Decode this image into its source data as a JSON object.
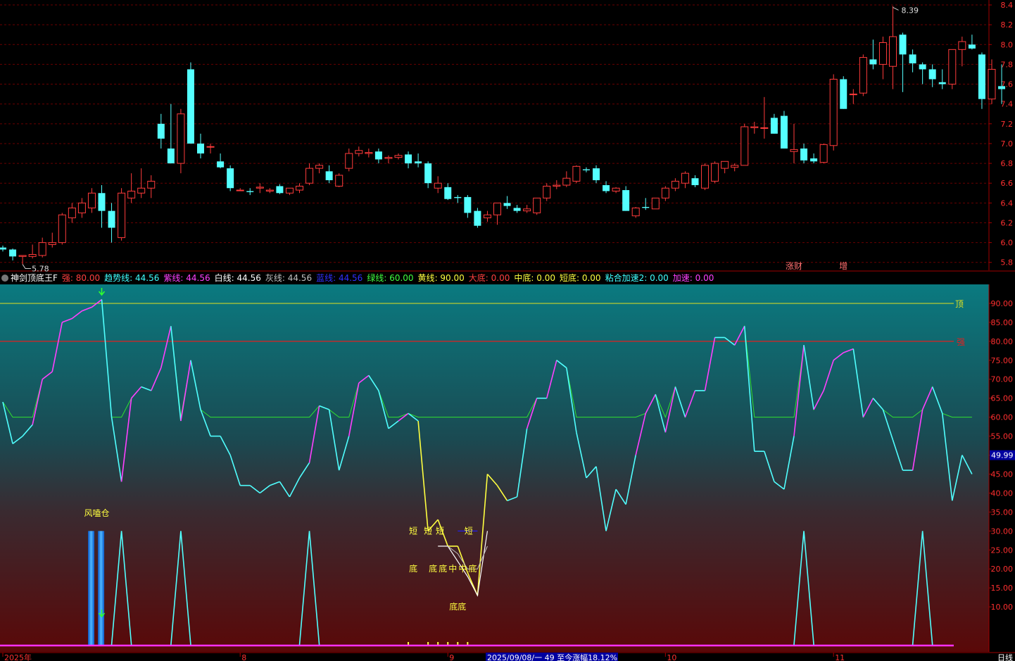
{
  "chart_data": [
    {
      "type": "candlestick",
      "y_ticks": [
        "8.4",
        "8.2",
        "8.0",
        "7.8",
        "7.6",
        "7.4",
        "7.2",
        "7.0",
        "6.8",
        "6.6",
        "6.4",
        "6.2",
        "6.0",
        "5.8"
      ],
      "ylim": [
        5.72,
        8.45
      ],
      "high_label": "8.39",
      "low_label": "5.78",
      "event_badges": [
        {
          "text": "涨财",
          "index": 80
        },
        {
          "text": "增",
          "index": 85
        }
      ],
      "up_color": "#ff3b3b",
      "down_color": "#54ffff",
      "candles": [
        [
          5.95,
          5.97,
          5.91,
          5.93
        ],
        [
          5.93,
          5.94,
          5.82,
          5.86
        ],
        [
          5.86,
          5.87,
          5.78,
          5.87
        ],
        [
          5.86,
          5.98,
          5.84,
          5.88
        ],
        [
          5.87,
          6.05,
          5.85,
          6.0
        ],
        [
          5.98,
          6.1,
          5.95,
          6.0
        ],
        [
          6.0,
          6.3,
          5.98,
          6.28
        ],
        [
          6.25,
          6.4,
          6.2,
          6.35
        ],
        [
          6.3,
          6.45,
          6.25,
          6.4
        ],
        [
          6.35,
          6.55,
          6.3,
          6.5
        ],
        [
          6.5,
          6.58,
          6.15,
          6.32
        ],
        [
          6.32,
          6.4,
          6.0,
          6.15
        ],
        [
          6.05,
          6.55,
          6.02,
          6.5
        ],
        [
          6.45,
          6.7,
          6.4,
          6.52
        ],
        [
          6.5,
          6.75,
          6.45,
          6.55
        ],
        [
          6.55,
          6.68,
          6.45,
          6.62
        ],
        [
          7.2,
          7.3,
          6.95,
          7.05
        ],
        [
          6.95,
          7.4,
          6.8,
          6.8
        ],
        [
          6.8,
          7.35,
          6.7,
          7.3
        ],
        [
          7.75,
          7.82,
          7.0,
          7.0
        ],
        [
          7.0,
          7.1,
          6.85,
          6.9
        ],
        [
          6.97,
          7.0,
          6.9,
          6.97
        ],
        [
          6.82,
          6.9,
          6.75,
          6.76
        ],
        [
          6.75,
          6.78,
          6.52,
          6.55
        ],
        [
          6.53,
          6.55,
          6.52,
          6.53
        ],
        [
          6.52,
          6.55,
          6.48,
          6.51
        ],
        [
          6.55,
          6.6,
          6.5,
          6.56
        ],
        [
          6.52,
          6.55,
          6.5,
          6.53
        ],
        [
          6.57,
          6.59,
          6.49,
          6.5
        ],
        [
          6.5,
          6.55,
          6.48,
          6.55
        ],
        [
          6.53,
          6.6,
          6.5,
          6.57
        ],
        [
          6.6,
          6.8,
          6.58,
          6.75
        ],
        [
          6.75,
          6.8,
          6.7,
          6.78
        ],
        [
          6.72,
          6.78,
          6.6,
          6.63
        ],
        [
          6.57,
          6.7,
          6.56,
          6.68
        ],
        [
          6.75,
          6.95,
          6.72,
          6.9
        ],
        [
          6.9,
          6.97,
          6.87,
          6.93
        ],
        [
          6.9,
          6.95,
          6.86,
          6.91
        ],
        [
          6.92,
          6.95,
          6.8,
          6.84
        ],
        [
          6.85,
          6.88,
          6.8,
          6.86
        ],
        [
          6.86,
          6.9,
          6.84,
          6.88
        ],
        [
          6.89,
          6.92,
          6.75,
          6.8
        ],
        [
          6.82,
          6.9,
          6.76,
          6.8
        ],
        [
          6.8,
          6.82,
          6.55,
          6.6
        ],
        [
          6.55,
          6.67,
          6.5,
          6.6
        ],
        [
          6.56,
          6.6,
          6.43,
          6.44
        ],
        [
          6.46,
          6.48,
          6.4,
          6.45
        ],
        [
          6.46,
          6.48,
          6.25,
          6.3
        ],
        [
          6.32,
          6.35,
          6.15,
          6.17
        ],
        [
          6.25,
          6.32,
          6.21,
          6.28
        ],
        [
          6.28,
          6.4,
          6.18,
          6.4
        ],
        [
          6.4,
          6.47,
          6.34,
          6.37
        ],
        [
          6.35,
          6.38,
          6.3,
          6.32
        ],
        [
          6.32,
          6.38,
          6.3,
          6.34
        ],
        [
          6.3,
          6.45,
          6.28,
          6.45
        ],
        [
          6.45,
          6.6,
          6.42,
          6.57
        ],
        [
          6.57,
          6.63,
          6.54,
          6.58
        ],
        [
          6.58,
          6.72,
          6.56,
          6.65
        ],
        [
          6.62,
          6.78,
          6.6,
          6.77
        ],
        [
          6.74,
          6.76,
          6.71,
          6.73
        ],
        [
          6.75,
          6.78,
          6.6,
          6.63
        ],
        [
          6.58,
          6.62,
          6.5,
          6.52
        ],
        [
          6.52,
          6.56,
          6.5,
          6.55
        ],
        [
          6.53,
          6.57,
          6.32,
          6.32
        ],
        [
          6.27,
          6.36,
          6.25,
          6.35
        ],
        [
          6.36,
          6.45,
          6.33,
          6.35
        ],
        [
          6.34,
          6.45,
          6.34,
          6.45
        ],
        [
          6.45,
          6.57,
          6.42,
          6.55
        ],
        [
          6.55,
          6.65,
          6.52,
          6.62
        ],
        [
          6.6,
          6.72,
          6.55,
          6.7
        ],
        [
          6.65,
          6.68,
          6.56,
          6.58
        ],
        [
          6.55,
          6.8,
          6.53,
          6.78
        ],
        [
          6.62,
          6.82,
          6.6,
          6.8
        ],
        [
          6.75,
          6.82,
          6.7,
          6.82
        ],
        [
          6.76,
          6.8,
          6.72,
          6.78
        ],
        [
          6.78,
          7.2,
          6.78,
          7.17
        ],
        [
          7.16,
          7.22,
          7.1,
          7.17
        ],
        [
          7.16,
          7.47,
          7.05,
          7.16
        ],
        [
          7.26,
          7.3,
          7.1,
          7.1
        ],
        [
          7.28,
          7.33,
          6.95,
          6.95
        ],
        [
          6.92,
          7.2,
          6.8,
          6.94
        ],
        [
          6.95,
          7.0,
          6.8,
          6.83
        ],
        [
          6.85,
          6.9,
          6.8,
          6.82
        ],
        [
          6.81,
          7.0,
          6.8,
          6.99
        ],
        [
          6.98,
          7.7,
          6.93,
          7.65
        ],
        [
          7.65,
          7.68,
          7.35,
          7.35
        ],
        [
          7.5,
          7.55,
          7.4,
          7.5
        ],
        [
          7.51,
          7.9,
          7.48,
          7.87
        ],
        [
          7.85,
          8.05,
          7.75,
          7.8
        ],
        [
          7.8,
          8.08,
          7.65,
          8.02
        ],
        [
          7.78,
          8.39,
          7.55,
          8.08
        ],
        [
          8.1,
          8.12,
          7.52,
          7.9
        ],
        [
          7.9,
          7.95,
          7.72,
          7.81
        ],
        [
          7.8,
          7.82,
          7.6,
          7.75
        ],
        [
          7.75,
          7.8,
          7.57,
          7.65
        ],
        [
          7.62,
          7.75,
          7.55,
          7.6
        ],
        [
          7.6,
          7.95,
          7.55,
          7.95
        ],
        [
          7.95,
          8.08,
          7.78,
          8.03
        ],
        [
          8.0,
          8.1,
          7.95,
          7.96
        ],
        [
          7.9,
          7.92,
          7.35,
          7.45
        ],
        [
          7.45,
          7.85,
          7.4,
          7.75
        ],
        [
          7.58,
          7.8,
          7.4,
          7.55
        ]
      ]
    },
    {
      "type": "line",
      "indicator_name": "神剑顶底王F",
      "legend": [
        {
          "label": "强",
          "value": "80.00",
          "label_color": "#ff4040",
          "value_color": "#ff4040"
        },
        {
          "label": "趋势线",
          "value": "44.56",
          "label_color": "#40ffff",
          "value_color": "#40ffff"
        },
        {
          "label": "紫线",
          "value": "44.56",
          "label_color": "#ff40ff",
          "value_color": "#ff40ff"
        },
        {
          "label": "白线",
          "value": "44.56",
          "label_color": "#ffffff",
          "value_color": "#ffffff"
        },
        {
          "label": "灰线",
          "value": "44.56",
          "label_color": "#c0c0c0",
          "value_color": "#c0c0c0"
        },
        {
          "label": "蓝线",
          "value": "44.56",
          "label_color": "#3030ff",
          "value_color": "#3030ff"
        },
        {
          "label": "绿线",
          "value": "60.00",
          "label_color": "#40ff40",
          "value_color": "#40ff40"
        },
        {
          "label": "黄线",
          "value": "90.00",
          "label_color": "#ffff40",
          "value_color": "#ffff40"
        },
        {
          "label": "大底",
          "value": "0.00",
          "label_color": "#ff4040",
          "value_color": "#ff4040"
        },
        {
          "label": "中底",
          "value": "0.00",
          "label_color": "#ffff40",
          "value_color": "#ffff40"
        },
        {
          "label": "短底",
          "value": "0.00",
          "label_color": "#ffff40",
          "value_color": "#ffff40"
        },
        {
          "label": "粘合加速2",
          "value": "0.00",
          "label_color": "#40ffff",
          "value_color": "#40ffff"
        },
        {
          "label": "加速",
          "value": "0.00",
          "label_color": "#ff40ff",
          "value_color": "#ff40ff"
        }
      ],
      "y_ticks": [
        "90.00",
        "85.00",
        "80.00",
        "75.00",
        "70.00",
        "65.00",
        "60.00",
        "55.00",
        "50.00",
        "45.00",
        "40.00",
        "35.00",
        "30.00",
        "25.00",
        "20.00",
        "15.00",
        "10.00"
      ],
      "ylim": [
        0,
        95
      ],
      "current_value_label": "49.99",
      "level_top_label": "顶",
      "level_strong_label": "强",
      "level_top": 90,
      "level_strong": 80,
      "level_green": 60,
      "trend": [
        64,
        53,
        55,
        58,
        70,
        72,
        85,
        86,
        88,
        89,
        91,
        60,
        43,
        65,
        68,
        67,
        73,
        84,
        59,
        75,
        62,
        55,
        55,
        50,
        42,
        42,
        40,
        42,
        43,
        39,
        44,
        48,
        63,
        62,
        46,
        55,
        69,
        71,
        67,
        57,
        59,
        61,
        59,
        30,
        33,
        26,
        26,
        19,
        13,
        45,
        42,
        38,
        39,
        57,
        65,
        65,
        75,
        73,
        56,
        44,
        47,
        30,
        41,
        37,
        50,
        61,
        66,
        56,
        68,
        60,
        67,
        67,
        81,
        81,
        79,
        84,
        51,
        51,
        43,
        41,
        55,
        79,
        62,
        67,
        75,
        77,
        78,
        60,
        65,
        62,
        54,
        46,
        46,
        62,
        68,
        61,
        38,
        50,
        45
      ],
      "bottom_spikes": [
        {
          "i": 12,
          "v": 30
        },
        {
          "i": 18,
          "v": 30
        },
        {
          "i": 31,
          "v": 30
        },
        {
          "i": 81,
          "v": 30
        },
        {
          "i": 93,
          "v": 30
        }
      ],
      "bars_caption": "风嗑仓",
      "short_labels": [
        "短",
        "短",
        "短",
        "短"
      ],
      "bottom_labels": [
        "底",
        "底",
        "底",
        "中",
        "中",
        "底"
      ],
      "bottom_labels_low": [
        "底底"
      ],
      "signal_index_top": 10,
      "signal_index_bottom": 10
    }
  ],
  "time_axis": {
    "labels": [
      {
        "text": "2025年",
        "index": 0
      },
      {
        "text": "8",
        "index": 24
      },
      {
        "text": "9",
        "index": 45
      },
      {
        "text": "10",
        "index": 67
      },
      {
        "text": "11",
        "index": 84
      }
    ],
    "status_text": "2025/09/08/一 49 至今涨幅18.12%",
    "period": "日线"
  }
}
